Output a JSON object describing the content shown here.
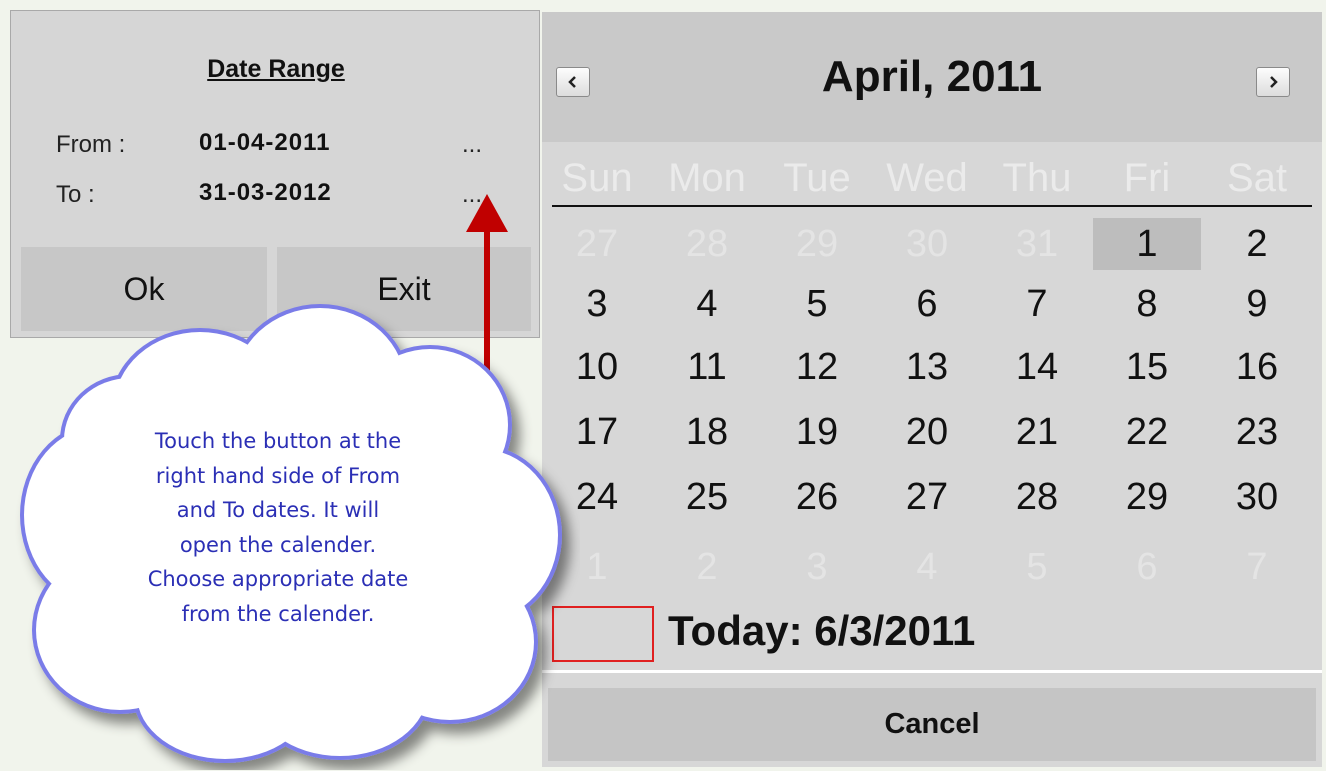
{
  "date_range": {
    "title": "Date Range",
    "from_label": "From :",
    "from_value": "01-04-2011",
    "to_label": "To :",
    "to_value": "31-03-2012",
    "picker_button_label": "...",
    "ok_label": "Ok",
    "exit_label": "Exit"
  },
  "calendar": {
    "month_title": "April, 2011",
    "prev_icon": "chevron-left-icon",
    "next_icon": "chevron-right-icon",
    "weekdays": [
      "Sun",
      "Mon",
      "Tue",
      "Wed",
      "Thu",
      "Fri",
      "Sat"
    ],
    "weeks": [
      [
        {
          "d": "27",
          "muted": true
        },
        {
          "d": "28",
          "muted": true
        },
        {
          "d": "29",
          "muted": true
        },
        {
          "d": "30",
          "muted": true
        },
        {
          "d": "31",
          "muted": true
        },
        {
          "d": "1",
          "sel": true
        },
        {
          "d": "2"
        }
      ],
      [
        {
          "d": "3"
        },
        {
          "d": "4"
        },
        {
          "d": "5"
        },
        {
          "d": "6"
        },
        {
          "d": "7"
        },
        {
          "d": "8"
        },
        {
          "d": "9"
        }
      ],
      [
        {
          "d": "10"
        },
        {
          "d": "11"
        },
        {
          "d": "12"
        },
        {
          "d": "13"
        },
        {
          "d": "14"
        },
        {
          "d": "15"
        },
        {
          "d": "16"
        }
      ],
      [
        {
          "d": "17"
        },
        {
          "d": "18"
        },
        {
          "d": "19"
        },
        {
          "d": "20"
        },
        {
          "d": "21"
        },
        {
          "d": "22"
        },
        {
          "d": "23"
        }
      ],
      [
        {
          "d": "24"
        },
        {
          "d": "25"
        },
        {
          "d": "26"
        },
        {
          "d": "27"
        },
        {
          "d": "28"
        },
        {
          "d": "29"
        },
        {
          "d": "30"
        }
      ],
      [
        {
          "d": "1",
          "muted": true
        },
        {
          "d": "2",
          "muted": true
        },
        {
          "d": "3",
          "muted": true
        },
        {
          "d": "4",
          "muted": true
        },
        {
          "d": "5",
          "muted": true
        },
        {
          "d": "6",
          "muted": true
        },
        {
          "d": "7",
          "muted": true
        }
      ]
    ],
    "today_text": "Today: 6/3/2011",
    "cancel_label": "Cancel"
  },
  "annotation": {
    "lines": [
      "Touch the button at the",
      "right hand side of From",
      "and To dates. It will",
      "open the calender.",
      "Choose appropriate date",
      "from the calender."
    ],
    "arrow_color": "#c00000",
    "cloud_border_color": "#7a7ce8"
  }
}
